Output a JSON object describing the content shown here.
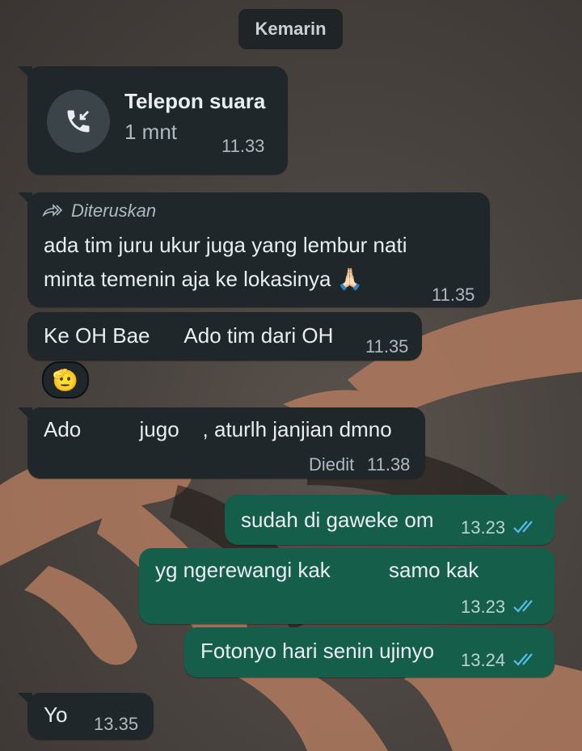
{
  "date_chip": "Kemarin",
  "call": {
    "title": "Telepon suara",
    "duration": "1 mnt",
    "time": "11.33",
    "icon": "incoming-call-icon"
  },
  "messages": [
    {
      "forwarded_label": "Diteruskan",
      "lines": [
        "ada tim juru ukur juga yang lembur nati",
        "minta temenin aja ke lokasinya 🙏🏻"
      ],
      "time": "11.35"
    },
    {
      "text": "Ke OH Bae      Ado tim dari OH",
      "time": "11.35",
      "reaction": "🫡"
    },
    {
      "text": "Ado          jugo    , aturlh janjian dmno",
      "edited_label": "Diedit",
      "time": "11.38"
    },
    {
      "text": "sudah di gaweke om",
      "time": "13.23"
    },
    {
      "text": "yg ngerewangi kak          samo kak",
      "time": "13.23"
    },
    {
      "text": "Fotonyo hari senin ujinyo",
      "time": "13.24"
    },
    {
      "text": "Yo",
      "time": "13.35"
    }
  ],
  "colors": {
    "incoming_bubble": "#1f272b",
    "outgoing_bubble": "#155e4a",
    "read_ticks": "#53bdeb"
  }
}
